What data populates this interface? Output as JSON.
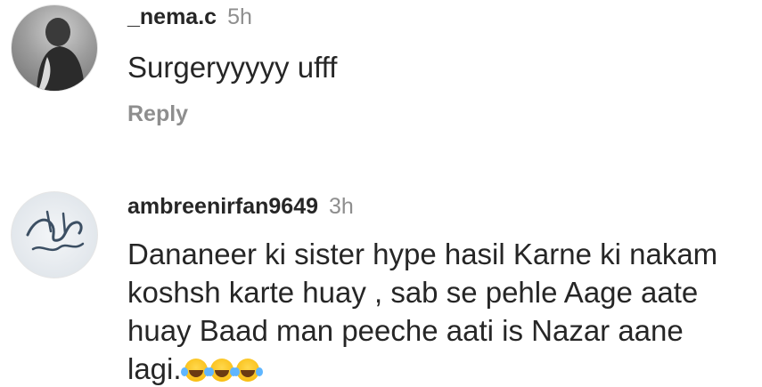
{
  "comments": [
    {
      "username": "_nema.c",
      "time": "5h",
      "text": "Surgeryyyyy ufff",
      "reply_label": "Reply"
    },
    {
      "username": "ambreenirfan9649",
      "time": "3h",
      "text_lines": [
        "Dananeer ki sister hype hasil Karne ki nakam",
        "koshsh karte huay , sab se pehle Aage aate",
        "huay Baad man peeche aati is Nazar aane",
        "lagi."
      ],
      "emoji_names": [
        "face-with-tears-of-joy-emoji",
        "face-with-tears-of-joy-emoji",
        "face-with-tears-of-joy-emoji"
      ]
    }
  ]
}
